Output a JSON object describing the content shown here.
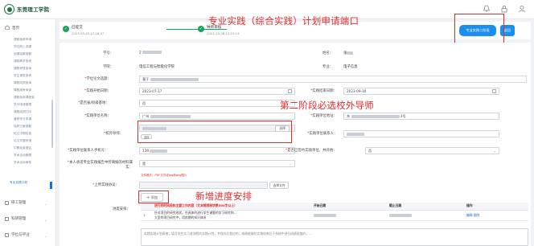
{
  "header": {
    "logo_text": "东莞理工学院"
  },
  "sidebar": {
    "home": "首页",
    "subs": [
      "课程免修申请",
      "学位网上选课",
      "选课结果查看",
      "课程教学查询",
      "课程考核查询",
      "学生课表查询",
      "课程成绩查询",
      "课程报考审查",
      "课程免修课程查",
      "学分申请管理",
      "课程成绩打印",
      "重修学分申请",
      "培养方案查看",
      "论文中期检查",
      "论文开题申请",
      "中期检查报告",
      "学术活动管理",
      "学术活动审核",
      "专业实践计划"
    ],
    "groups": [
      "研工管理",
      "科研管理",
      "学位与学业"
    ]
  },
  "status": {
    "step1_title": "已提交",
    "step1_time": "2023-09-25 17:18:47",
    "step2_title": "导师审核",
    "step2_time": "2023-10-08 23:23:13",
    "apply_btn": "专业实践二阶段",
    "back_btn": "返回"
  },
  "annotations": {
    "a1": "专业实践（综合实践）计划申请端口",
    "a2": "第二阶段必选校外导师",
    "a3": "新增进度安排"
  },
  "form": {
    "student_no_label": "学号：",
    "student_no": "2",
    "name_label": "姓名：",
    "name": "张",
    "college_label": "学院：",
    "college": "电信工程与智能化学院",
    "major_label": "专业：",
    "major": "电子信息",
    "thesis_label": "学位论文选题：",
    "thesis_prefix": "基于",
    "start_label": "实践开始日期：",
    "start_date": "2023-07-17",
    "end_label": "实践结束日期：",
    "end_date": "2023-09-30",
    "base_label": "是否省/校级基地：",
    "base_value": "否",
    "unit_label": "实践单位名称：",
    "unit_prefix": "广州",
    "addr_label": "实践单位地址：",
    "addr_prefix": "东",
    "addr_suffix": "1号",
    "mentor_label": "校外导师：",
    "choose_btn": "选择",
    "choose_btn2": "选择",
    "contact_label": "实践单位联系人：",
    "contact_phone_label": "实践单位联系人手机号：",
    "contact_phone": "139",
    "signed_label": "是否已签约实践单位，并开始：",
    "signed_value": "否",
    "material_label": "本人承诺专业实践报告中所填报的材料属实：",
    "material_value": "是",
    "upload_label": "上传实践协议：",
    "upload_hint": "文件格式：PDF文件或jpg和png图片",
    "upload_file": "选择文件",
    "add_btn": "十 添加",
    "prog_label": "进度安排：",
    "prog_cols": [
      "进行的时间段和主要工作内容（文本框限制字数500字以上）",
      "开始日期",
      "截止日期",
      "操作"
    ],
    "prog_row_idx": "1",
    "prog_row_text": "针对项目的研究现状，在具体的进行学生课题的学习研究和...",
    "prog_row_text2": "大型的项目研究中，用前期的知识体系",
    "prog_edit": "编辑",
    "prog_del": "删除",
    "bottom_text": "实践实践计划表格，填写学生实习各流程的实践计划，并保存后相应的，成绩能够在实践结束后于系统中进行成绩批复的，..."
  }
}
